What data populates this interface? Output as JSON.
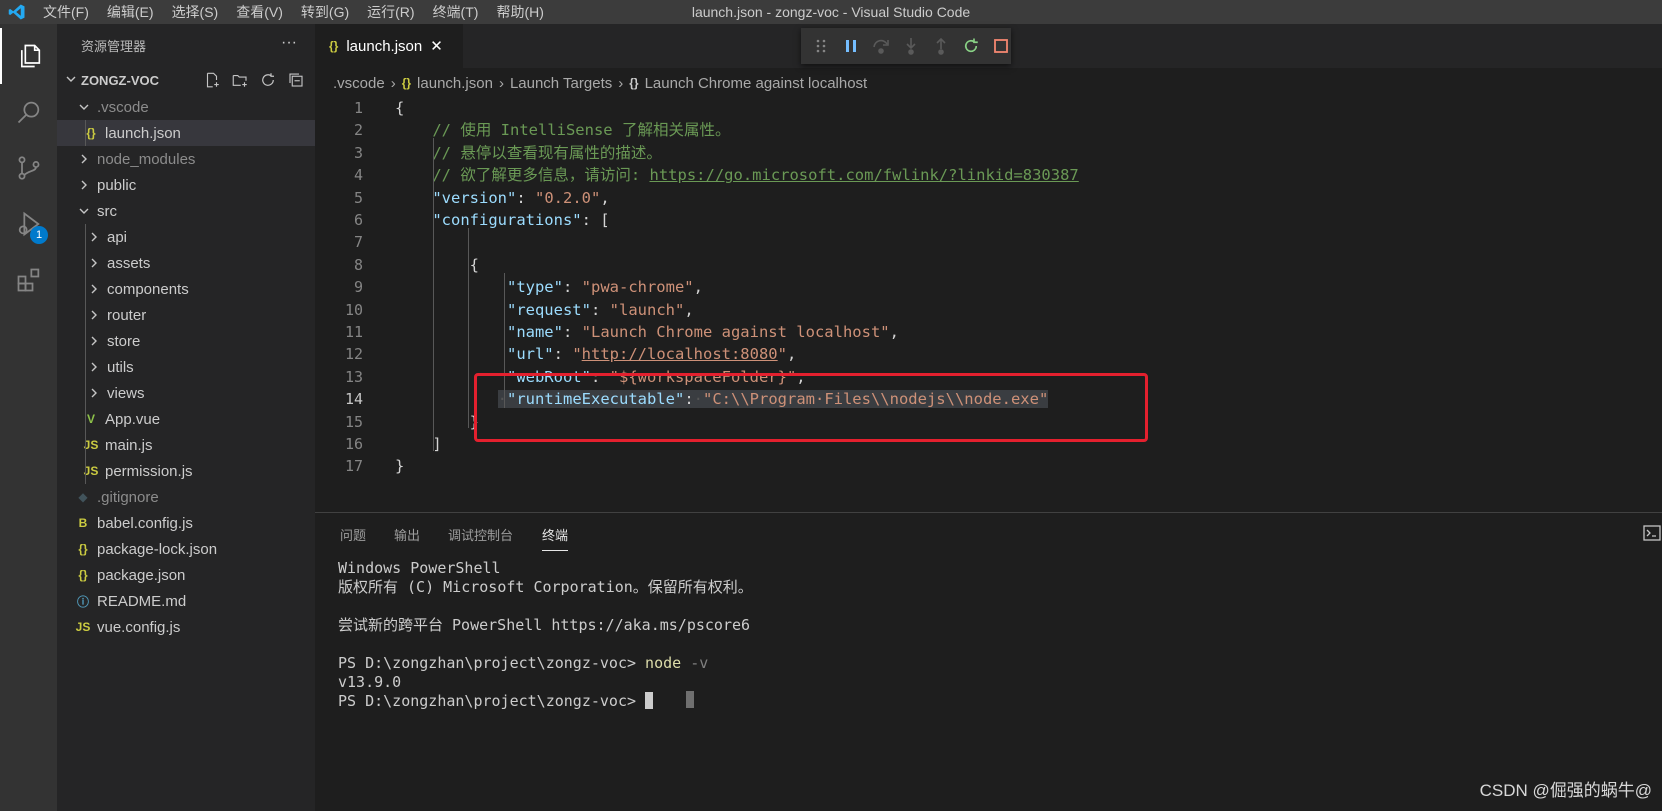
{
  "titlebar": {
    "menu": [
      "文件(F)",
      "编辑(E)",
      "选择(S)",
      "查看(V)",
      "转到(G)",
      "运行(R)",
      "终端(T)",
      "帮助(H)"
    ],
    "window_title": "launch.json - zongz-voc - Visual Studio Code"
  },
  "activitybar": {
    "debug_badge": "1"
  },
  "sidebar": {
    "title": "资源管理器",
    "more": "···",
    "project": "ZONGZ-VOC",
    "tree": [
      {
        "label": ".vscode",
        "type": "folder-open",
        "depth": 1
      },
      {
        "label": "launch.json",
        "type": "json",
        "depth": 2,
        "selected": true
      },
      {
        "label": "node_modules",
        "type": "folder",
        "depth": 1
      },
      {
        "label": "public",
        "type": "folder",
        "depth": 1
      },
      {
        "label": "src",
        "type": "folder-open",
        "depth": 1
      },
      {
        "label": "api",
        "type": "folder",
        "depth": 2
      },
      {
        "label": "assets",
        "type": "folder",
        "depth": 2
      },
      {
        "label": "components",
        "type": "folder",
        "depth": 2
      },
      {
        "label": "router",
        "type": "folder",
        "depth": 2
      },
      {
        "label": "store",
        "type": "folder",
        "depth": 2
      },
      {
        "label": "utils",
        "type": "folder",
        "depth": 2
      },
      {
        "label": "views",
        "type": "folder",
        "depth": 2
      },
      {
        "label": "App.vue",
        "type": "vue",
        "depth": 2
      },
      {
        "label": "main.js",
        "type": "js",
        "depth": 2
      },
      {
        "label": "permission.js",
        "type": "js",
        "depth": 2
      },
      {
        "label": ".gitignore",
        "type": "git",
        "depth": 1
      },
      {
        "label": "babel.config.js",
        "type": "babel",
        "depth": 1
      },
      {
        "label": "package-lock.json",
        "type": "json",
        "depth": 1
      },
      {
        "label": "package.json",
        "type": "json",
        "depth": 1
      },
      {
        "label": "README.md",
        "type": "info",
        "depth": 1
      },
      {
        "label": "vue.config.js",
        "type": "js",
        "depth": 1
      }
    ]
  },
  "tab": {
    "icon": "{}",
    "label": "launch.json",
    "close": "✕"
  },
  "breadcrumb": {
    "parts": [
      ".vscode",
      "launch.json",
      "Launch Targets",
      "Launch Chrome against localhost"
    ],
    "sep": "›",
    "icon": "{}"
  },
  "editor": {
    "line_numbers": [
      "1",
      "2",
      "3",
      "4",
      "5",
      "6",
      "7",
      "8",
      "9",
      "10",
      "11",
      "12",
      "13",
      "14",
      "15",
      "16",
      "17"
    ],
    "current_line": "14",
    "lines": [
      [
        {
          "t": "{",
          "c": "pun"
        }
      ],
      [
        {
          "t": "    // 使用 IntelliSense 了解相关属性。",
          "c": "com"
        }
      ],
      [
        {
          "t": "    // 悬停以查看现有属性的描述。",
          "c": "com"
        }
      ],
      [
        {
          "t": "    // 欲了解更多信息，请访问: ",
          "c": "com"
        },
        {
          "t": "https://go.microsoft.com/fwlink/?linkid=830387",
          "c": "com url"
        }
      ],
      [
        {
          "t": "    ",
          "c": "pun"
        },
        {
          "t": "\"version\"",
          "c": "key"
        },
        {
          "t": ": ",
          "c": "pun"
        },
        {
          "t": "\"0.2.0\"",
          "c": "str"
        },
        {
          "t": ",",
          "c": "pun"
        }
      ],
      [
        {
          "t": "    ",
          "c": "pun"
        },
        {
          "t": "\"configurations\"",
          "c": "key"
        },
        {
          "t": ": [",
          "c": "pun"
        }
      ],
      [
        {
          "t": "",
          "c": "pun"
        }
      ],
      [
        {
          "t": "        {",
          "c": "pun"
        }
      ],
      [
        {
          "t": "            ",
          "c": "pun"
        },
        {
          "t": "\"type\"",
          "c": "key"
        },
        {
          "t": ": ",
          "c": "pun"
        },
        {
          "t": "\"pwa-chrome\"",
          "c": "str"
        },
        {
          "t": ",",
          "c": "pun"
        }
      ],
      [
        {
          "t": "            ",
          "c": "pun"
        },
        {
          "t": "\"request\"",
          "c": "key"
        },
        {
          "t": ": ",
          "c": "pun"
        },
        {
          "t": "\"launch\"",
          "c": "str"
        },
        {
          "t": ",",
          "c": "pun"
        }
      ],
      [
        {
          "t": "            ",
          "c": "pun"
        },
        {
          "t": "\"name\"",
          "c": "key"
        },
        {
          "t": ": ",
          "c": "pun"
        },
        {
          "t": "\"Launch Chrome against localhost\"",
          "c": "str"
        },
        {
          "t": ",",
          "c": "pun"
        }
      ],
      [
        {
          "t": "            ",
          "c": "pun"
        },
        {
          "t": "\"url\"",
          "c": "key"
        },
        {
          "t": ": ",
          "c": "pun"
        },
        {
          "t": "\"",
          "c": "str"
        },
        {
          "t": "http://localhost:8080",
          "c": "str url"
        },
        {
          "t": "\"",
          "c": "str"
        },
        {
          "t": ",",
          "c": "pun"
        }
      ],
      [
        {
          "t": "            ",
          "c": "pun"
        },
        {
          "t": "\"webRoot\"",
          "c": "key"
        },
        {
          "t": ": ",
          "c": "pun"
        },
        {
          "t": "\"${workspaceFolder}\"",
          "c": "str"
        },
        {
          "t": ",",
          "c": "pun"
        }
      ],
      [
        {
          "t": "           ",
          "c": "pun"
        },
        {
          "t": "·",
          "c": "ws hl"
        },
        {
          "t": "\"runtimeExecutable\"",
          "c": "key hl"
        },
        {
          "t": ":",
          "c": "pun hl"
        },
        {
          "t": "·",
          "c": "ws hl"
        },
        {
          "t": "\"C:\\\\Program·Files\\\\nodejs\\\\node.exe\"",
          "c": "str hl"
        }
      ],
      [
        {
          "t": "        }",
          "c": "pun"
        }
      ],
      [
        {
          "t": "    ]",
          "c": "pun"
        }
      ],
      [
        {
          "t": "}",
          "c": "pun"
        }
      ]
    ]
  },
  "panel": {
    "tabs": [
      "问题",
      "输出",
      "调试控制台",
      "终端"
    ],
    "active_tab": "终端",
    "terminal": {
      "l1": "Windows PowerShell",
      "l2": "版权所有 (C) Microsoft Corporation。保留所有权利。",
      "l3": "尝试新的跨平台 PowerShell https://aka.ms/pscore6",
      "l4_prompt": "PS D:\\zongzhan\\project\\zongz-voc> ",
      "l4_cmd": "node",
      "l4_arg": " -v",
      "l5": "v13.9.0",
      "l6_prompt": "PS D:\\zongzhan\\project\\zongz-voc> "
    },
    "watermark": "CSDN @倔强的蜗牛@"
  },
  "colors": {
    "accent": "#007acc",
    "annotation_box": "#e4202e"
  }
}
